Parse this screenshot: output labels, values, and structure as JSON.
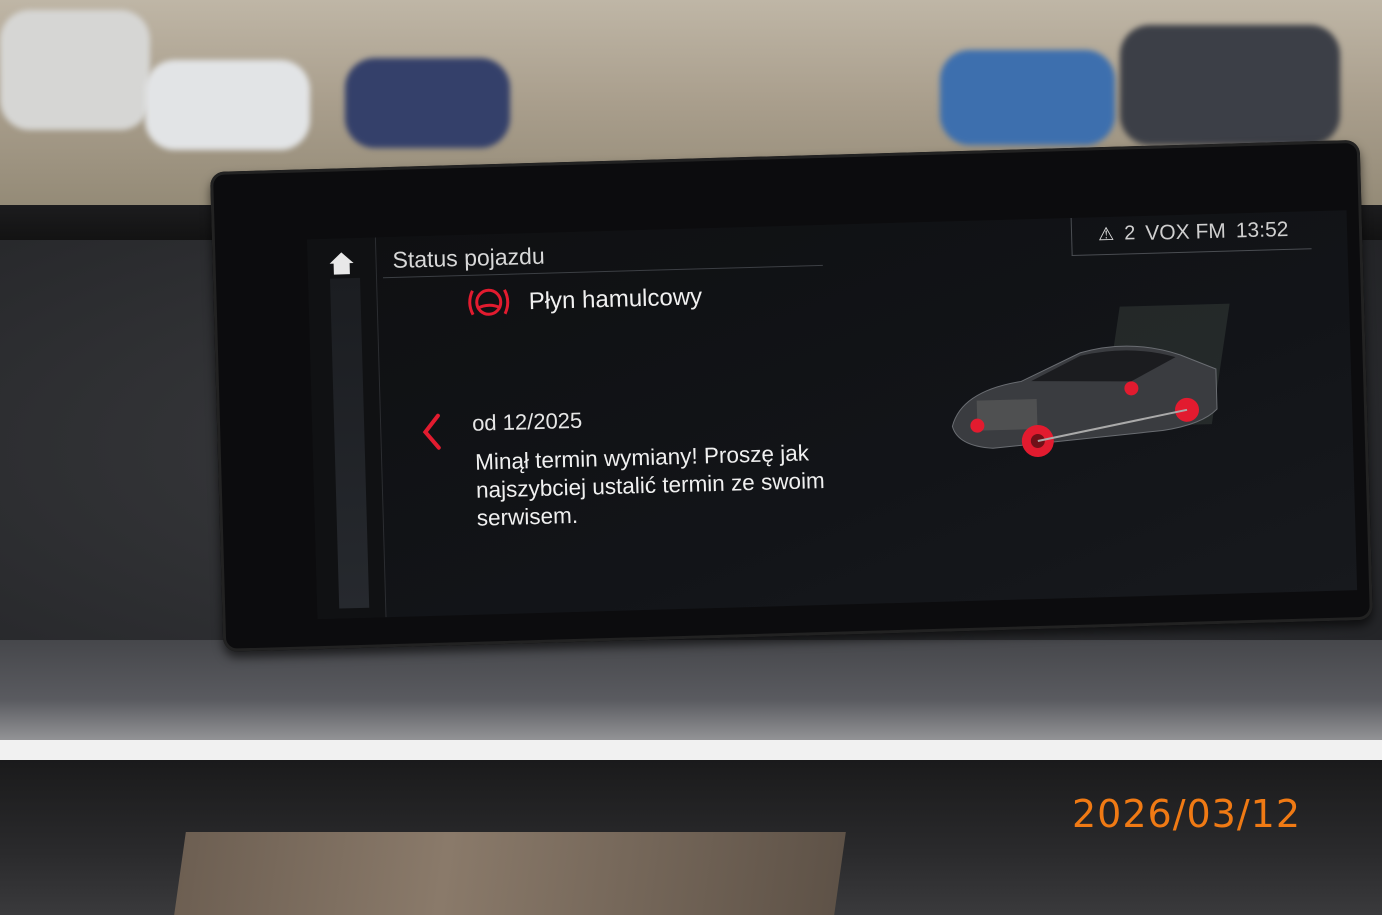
{
  "screen": {
    "header_title": "Status pojazdu",
    "status_bar": {
      "warning_count": "2",
      "radio_station": "VOX FM",
      "time": "13:52"
    },
    "item": {
      "title": "Płyn hamulcowy",
      "icon": "brake-fluid-warning-icon",
      "date_label": "od 12/2025",
      "message": "Minął termin wymiany! Proszę jak najszybciej ustalić termin ze swoim serwisem."
    },
    "colors": {
      "warning_red": "#e21b2f",
      "text": "#f0f0f0",
      "background": "#121418"
    }
  },
  "photo": {
    "date_stamp": "2026/03/12"
  }
}
